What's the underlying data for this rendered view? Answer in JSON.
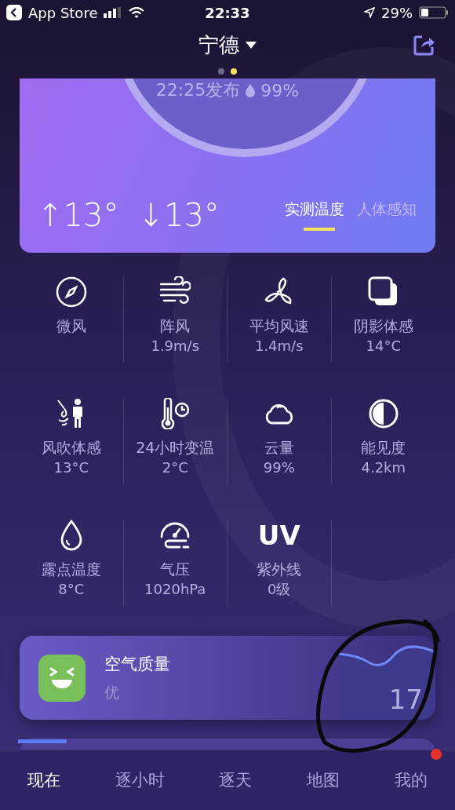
{
  "status_bar": {
    "back_label": "App Store",
    "time": "22:33",
    "battery": "29%"
  },
  "header": {
    "city": "宁德",
    "page_dots": [
      {
        "selected": false
      },
      {
        "selected": true
      }
    ]
  },
  "summary": {
    "published": "22:25发布",
    "humidity": "99%",
    "high": "↑13°",
    "low": "↓13°",
    "tabs": [
      {
        "label": "实测温度",
        "selected": true
      },
      {
        "label": "人体感知",
        "selected": false
      }
    ]
  },
  "details": [
    {
      "kind": "compass",
      "label": "微风"
    },
    {
      "kind": "wind",
      "label": "阵风",
      "value": "1.9m/s"
    },
    {
      "kind": "fan",
      "label": "平均风速",
      "value": "1.4m/s"
    },
    {
      "kind": "shadow",
      "label": "阴影体感",
      "value": "14°C"
    },
    {
      "kind": "person-wind",
      "label": "风吹体感",
      "value": "13°C"
    },
    {
      "kind": "thermometer-clock",
      "label": "24小时变温",
      "value": "2°C"
    },
    {
      "kind": "cloud",
      "label": "云量",
      "value": "99%"
    },
    {
      "kind": "half-circle",
      "label": "能见度",
      "value": "4.2km"
    },
    {
      "kind": "drop",
      "label": "露点温度",
      "value": "8°C"
    },
    {
      "kind": "gauge",
      "label": "气压",
      "value": "1020hPa"
    },
    {
      "kind": "text",
      "icon_text": "UV",
      "label": "紫外线",
      "value": "0级"
    }
  ],
  "air_quality": {
    "title": "空气质量",
    "level": "优",
    "value": "17"
  },
  "bottom_tabs": [
    {
      "label": "现在",
      "selected": true,
      "badge": false
    },
    {
      "label": "逐小时",
      "selected": false,
      "badge": false
    },
    {
      "label": "逐天",
      "selected": false,
      "badge": false
    },
    {
      "label": "地图",
      "selected": false,
      "badge": false
    },
    {
      "label": "我的",
      "selected": false,
      "badge": true
    }
  ]
}
